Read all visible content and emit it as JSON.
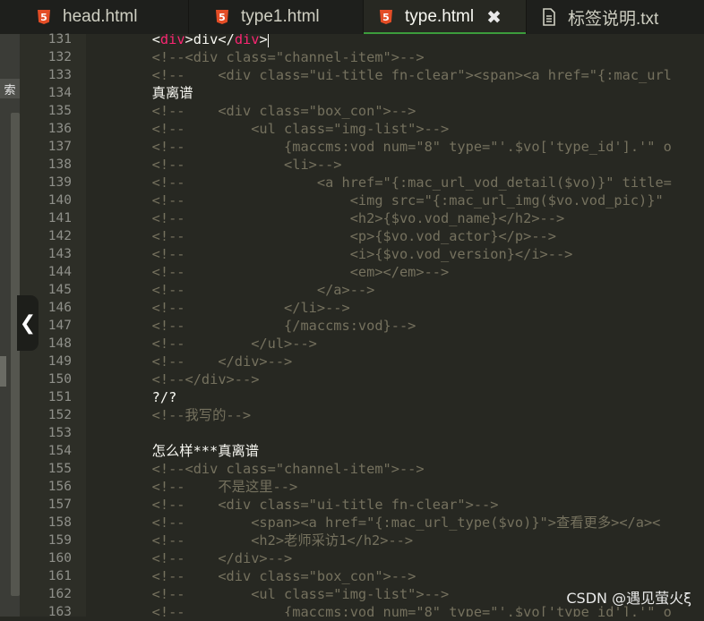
{
  "tabs": [
    {
      "label": "head.html",
      "icon": "html5-icon",
      "active": false
    },
    {
      "label": "type1.html",
      "icon": "html5-icon",
      "active": false
    },
    {
      "label": "type.html",
      "icon": "html5-icon",
      "active": true,
      "close": "✖"
    },
    {
      "label": "标签说明.txt",
      "icon": "document-icon",
      "active": false
    }
  ],
  "side_panel": {
    "label": "索",
    "collapse_glyph": "❮"
  },
  "editor": {
    "line_numbers": [
      "131",
      "132",
      "133",
      "134",
      "135",
      "136",
      "137",
      "138",
      "139",
      "140",
      "141",
      "142",
      "143",
      "144",
      "145",
      "146",
      "147",
      "148",
      "149",
      "150",
      "151",
      "152",
      "153",
      "154",
      "155",
      "156",
      "157",
      "158",
      "159",
      "160",
      "161",
      "162",
      "163"
    ],
    "line131": {
      "open": "<",
      "tag1": "div",
      "mid": ">div</",
      "tag2": "div",
      "close": ">"
    },
    "lines": [
      "",
      "        <!--<div class=\"channel-item\">-->",
      "        <!--    <div class=\"ui-title fn-clear\"><span><a href=\"{:mac_url",
      "        真离谱",
      "        <!--    <div class=\"box_con\">-->",
      "        <!--        <ul class=\"img-list\">-->",
      "        <!--            {maccms:vod num=\"8\" type=\"'.$vo['type_id'].'\" o",
      "        <!--            <li>-->",
      "        <!--                <a href=\"{:mac_url_vod_detail($vo)}\" title=",
      "        <!--                    <img src=\"{:mac_url_img($vo.vod_pic)}\" ",
      "        <!--                    <h2>{$vo.vod_name}</h2>-->",
      "        <!--                    <p>{$vo.vod_actor}</p>-->",
      "        <!--                    <i>{$vo.vod_version}</i>-->",
      "        <!--                    <em></em>-->",
      "        <!--                </a>-->",
      "        <!--            </li>-->",
      "        <!--            {/maccms:vod}-->",
      "        <!--        </ul>-->",
      "        <!--    </div>-->",
      "        <!--</div>-->",
      "        ?/?",
      "        <!--我写的-->",
      "",
      "        怎么样***真离谱",
      "        <!--<div class=\"channel-item\">-->",
      "        <!--    不是这里-->",
      "        <!--    <div class=\"ui-title fn-clear\">-->",
      "        <!--        <span><a href=\"{:mac_url_type($vo)}\">查看更多></a><",
      "        <!--        <h2>老师采访1</h2>-->",
      "        <!--    </div>-->",
      "        <!--    <div class=\"box_con\">-->",
      "        <!--        <ul class=\"img-list\">-->",
      "        <!--            {maccms:vod num=\"8\" type=\"'.$vo['type_id'].'\" o"
    ],
    "plain_lines": [
      3,
      20,
      23
    ]
  },
  "watermark": "CSDN @遇见萤火ξ",
  "colors": {
    "background": "#272822",
    "comment": "#75715e",
    "text": "#f8f8f2",
    "tag": "#f92672",
    "html5": "#e44d26",
    "active_tab_underline": "#3c9c3c"
  }
}
